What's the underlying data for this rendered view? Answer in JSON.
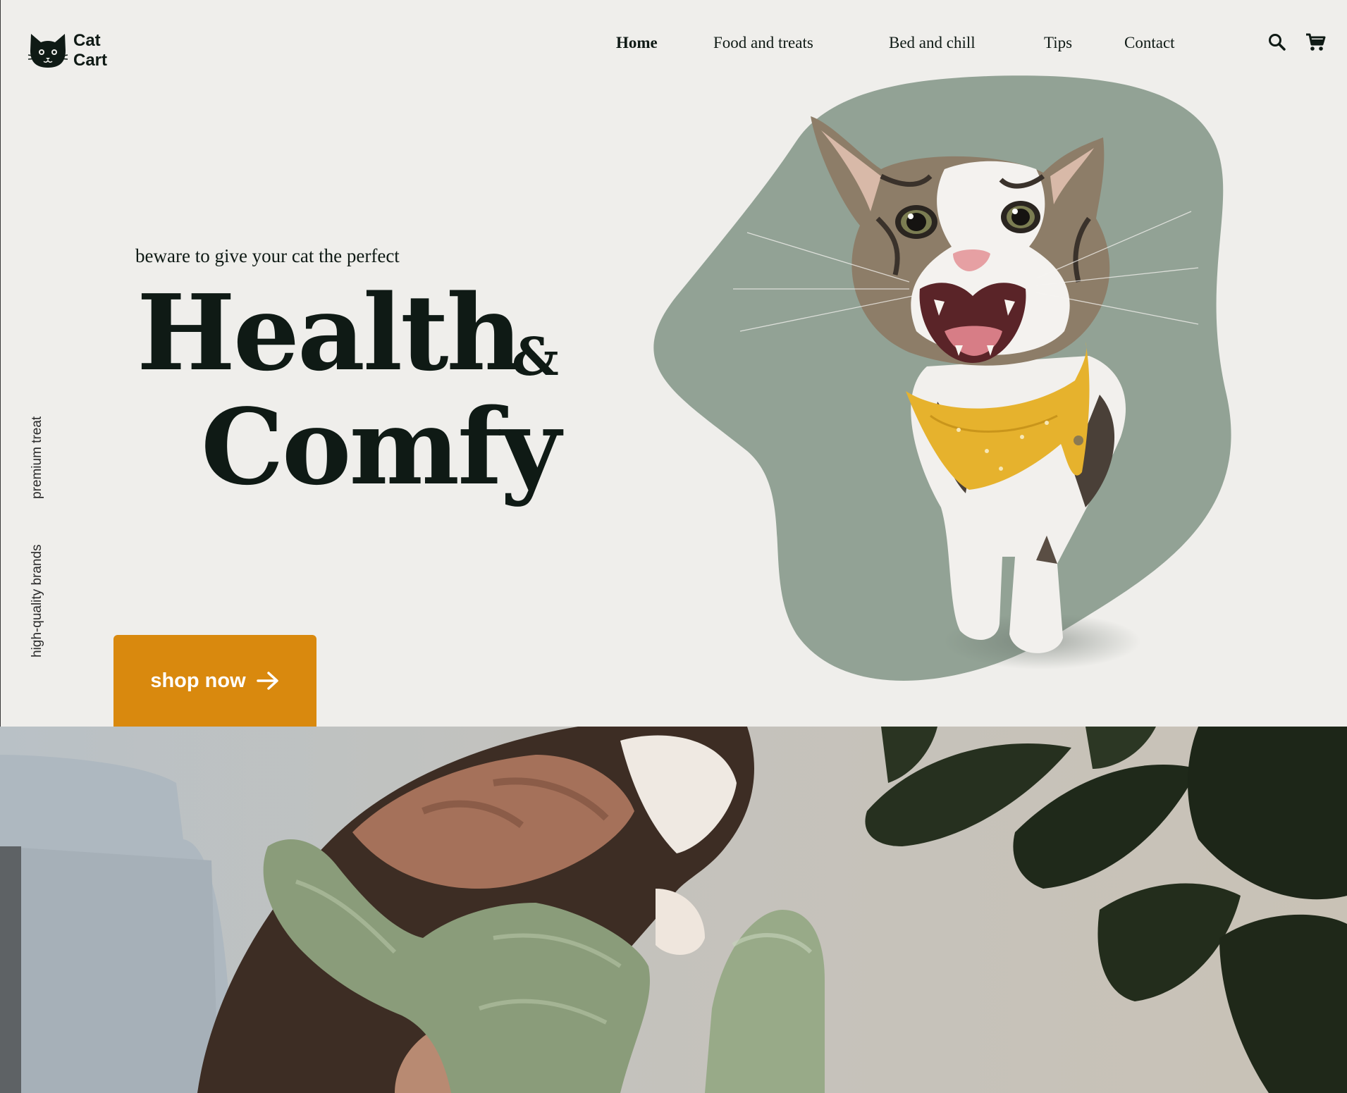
{
  "brand": {
    "line1": "Cat",
    "line2": "Cart",
    "logo_icon": "cat-face-icon"
  },
  "nav": {
    "items": [
      {
        "label": "Home",
        "active": true
      },
      {
        "label": "Food and treats",
        "active": false
      },
      {
        "label": "Bed and chill",
        "active": false
      },
      {
        "label": "Tips",
        "active": false
      },
      {
        "label": "Contact",
        "active": false
      }
    ],
    "icons": [
      "search-icon",
      "cart-icon"
    ]
  },
  "hero": {
    "tagline": "beware to give your cat the perfect",
    "headline_1": "Health",
    "headline_amp": "&",
    "headline_2": "Comfy",
    "side_labels": [
      "premium treat",
      "high-quality brands"
    ],
    "cta_label": "shop now",
    "cta_icon": "arrow-right-icon"
  },
  "colors": {
    "background": "#efeeeb",
    "text": "#0f1a15",
    "accent": "#d9890e",
    "blob": "#92a295",
    "bandana": "#e6b22d"
  }
}
